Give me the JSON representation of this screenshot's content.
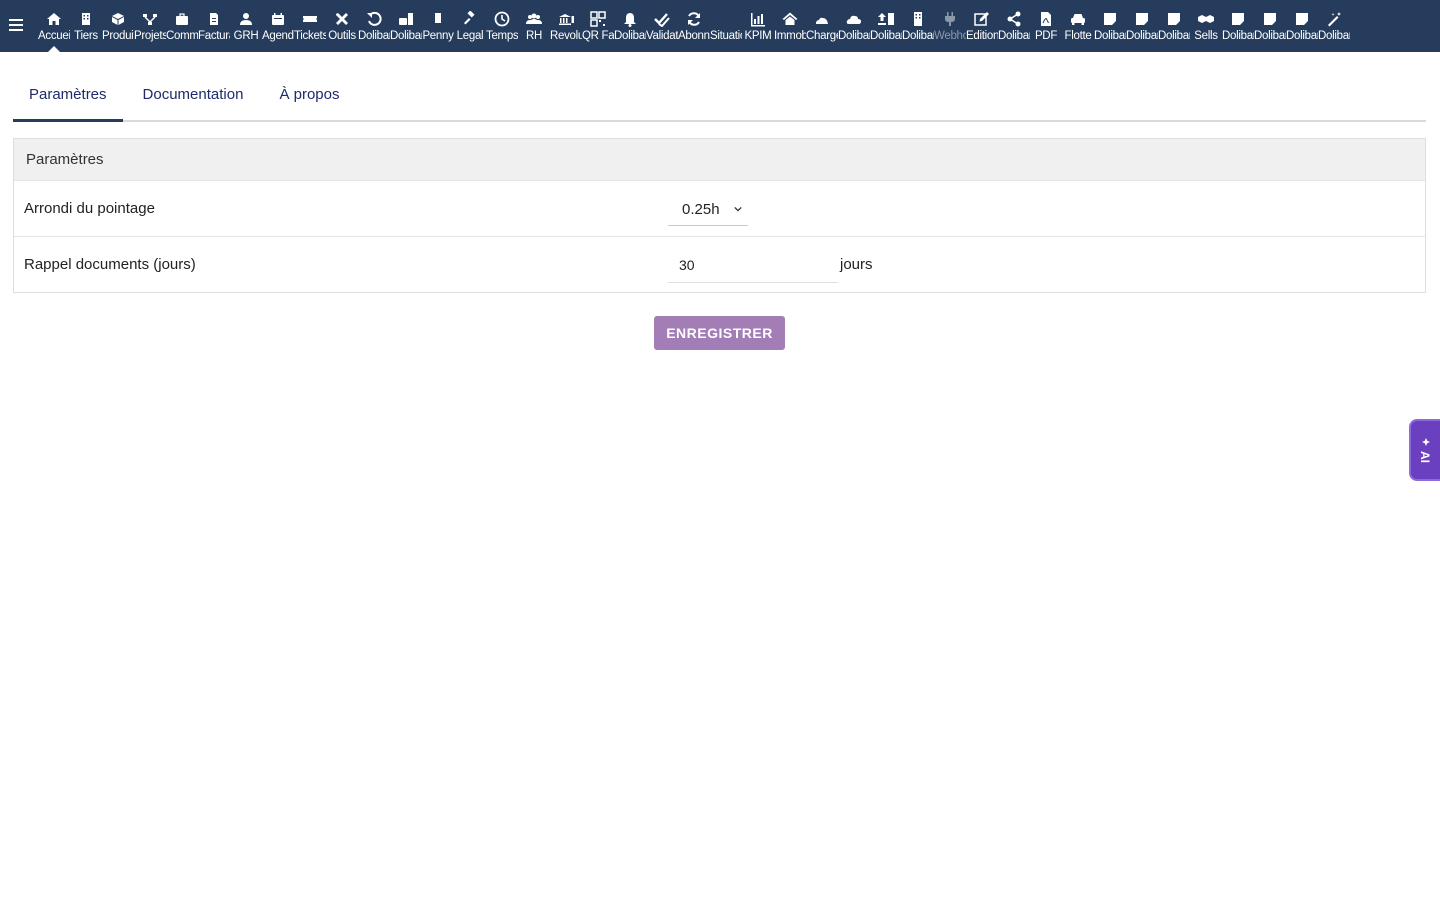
{
  "topbar": {
    "items": [
      {
        "label": "Accueil",
        "icon": "home-icon",
        "active": true
      },
      {
        "label": "Tiers",
        "icon": "building-icon"
      },
      {
        "label": "Produits",
        "icon": "cube-icon"
      },
      {
        "label": "Projets",
        "icon": "sitemap-icon"
      },
      {
        "label": "Commercial",
        "icon": "briefcase-icon"
      },
      {
        "label": "Facturation",
        "icon": "invoice-icon"
      },
      {
        "label": "GRH",
        "icon": "user-tie-icon"
      },
      {
        "label": "Agenda",
        "icon": "calendar-icon"
      },
      {
        "label": "Tickets",
        "icon": "ticket-icon"
      },
      {
        "label": "Outils",
        "icon": "tools-icon"
      },
      {
        "label": "Dolibarr",
        "icon": "undo-icon"
      },
      {
        "label": "Dolibarr",
        "icon": "briefcase-doc-icon"
      },
      {
        "label": "Penny",
        "icon": "document-icon"
      },
      {
        "label": "Legal",
        "icon": "gavel-icon"
      },
      {
        "label": "Temps",
        "icon": "clock-icon"
      },
      {
        "label": "RH",
        "icon": "users-icon"
      },
      {
        "label": "Revolut",
        "icon": "bank-icon"
      },
      {
        "label": "QR Facture",
        "icon": "qrcode-icon"
      },
      {
        "label": "Dolibarr",
        "icon": "bell-icon"
      },
      {
        "label": "Validation",
        "icon": "check-double-icon"
      },
      {
        "label": "Abonnements",
        "icon": "sync-icon"
      },
      {
        "label": "Situations",
        "icon": "blank-icon"
      },
      {
        "label": "KPIM",
        "icon": "chart-bar-icon"
      },
      {
        "label": "Immobilier",
        "icon": "house-icon"
      },
      {
        "label": "Charges",
        "icon": "cloud-low-icon"
      },
      {
        "label": "Dolibarr",
        "icon": "cloud-icon"
      },
      {
        "label": "Dolibarr",
        "icon": "upload-icon"
      },
      {
        "label": "Dolibarr",
        "icon": "office-building-icon"
      },
      {
        "label": "Webhooks",
        "icon": "plug-icon",
        "dim": true
      },
      {
        "label": "Edition",
        "icon": "edit-icon"
      },
      {
        "label": "Dolibarr",
        "icon": "share-icon"
      },
      {
        "label": "PDF",
        "icon": "file-pdf-icon"
      },
      {
        "label": "Flotte",
        "icon": "car-icon"
      },
      {
        "label": "Dolibarr",
        "icon": "note-icon"
      },
      {
        "label": "Dolibarr",
        "icon": "note-icon"
      },
      {
        "label": "Dolibarr",
        "icon": "note-icon"
      },
      {
        "label": "Sells",
        "icon": "handshake-icon"
      },
      {
        "label": "Dolibarr",
        "icon": "note-icon"
      },
      {
        "label": "Dolibarr",
        "icon": "note-icon"
      },
      {
        "label": "Dolibarr",
        "icon": "note-icon"
      },
      {
        "label": "Dolibarr",
        "icon": "magic-icon"
      }
    ]
  },
  "tabs": [
    {
      "label": "Paramètres",
      "active": true
    },
    {
      "label": "Documentation"
    },
    {
      "label": "À propos"
    }
  ],
  "panel": {
    "title": "Paramètres",
    "rounding": {
      "label": "Arrondi du pointage",
      "value": "0.25h"
    },
    "reminder": {
      "label": "Rappel documents (jours)",
      "value": "30",
      "unit": "jours"
    }
  },
  "save_label": "ENREGISTRER",
  "ai_label": "AI",
  "colors": {
    "topbar": "#263c5c",
    "accent": "#a27db6",
    "ai": "#6a3fc0"
  }
}
